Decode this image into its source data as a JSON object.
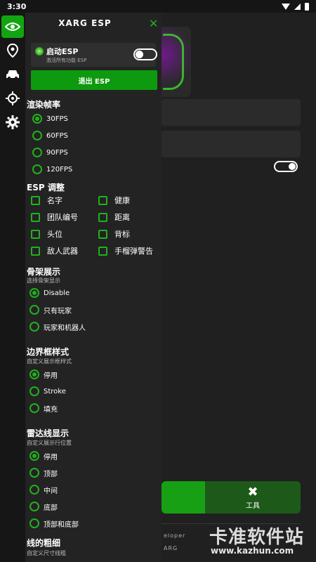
{
  "status": {
    "time": "3:30"
  },
  "panel": {
    "title": "XARG ESP",
    "close": "✕",
    "enable": {
      "title": "启动ESP",
      "subtitle": "激活所有功能 ESP"
    },
    "exit_button": "退出 ESP",
    "fps": {
      "title": "渲染帧率",
      "options": [
        "30FPS",
        "60FPS",
        "90FPS",
        "120FPS"
      ],
      "selected": "30FPS"
    },
    "esp_adjust": {
      "title": "ESP 调整",
      "left": [
        "名字",
        "团队编号",
        "头位",
        "敌人武器"
      ],
      "right": [
        "健康",
        "距离",
        "背标",
        "手榴弹警告"
      ]
    },
    "skeleton": {
      "title": "骨架展示",
      "subtitle": "选择骨架显示",
      "options": [
        "Disable",
        "只有玩家",
        "玩家和机器人"
      ],
      "selected": "Disable"
    },
    "border": {
      "title": "边界框样式",
      "subtitle": "自定义展示框样式",
      "options": [
        "停用",
        "Stroke",
        "填充"
      ],
      "selected": "停用"
    },
    "radar": {
      "title": "雷达线显示",
      "subtitle": "自定义展示行位置",
      "options": [
        "停用",
        "顶部",
        "中间",
        "底部",
        "顶部和底部"
      ],
      "selected": "停用"
    },
    "thickness": {
      "title": "线的粗细",
      "subtitle": "自定义尺寸线粗"
    }
  },
  "background": {
    "tool_tab_label": "工具",
    "developer_text": "eloper",
    "developer_sub": "ARG"
  },
  "rail": {
    "icons": [
      "eye-icon",
      "map-pin-icon",
      "car-icon",
      "crosshair-icon",
      "gear-icon"
    ]
  },
  "watermark": {
    "brand": "卡准软件站",
    "url": "www.kazhun.com"
  },
  "colors": {
    "accent": "#21b11c",
    "panel": "#232323",
    "rail": "#161616"
  }
}
